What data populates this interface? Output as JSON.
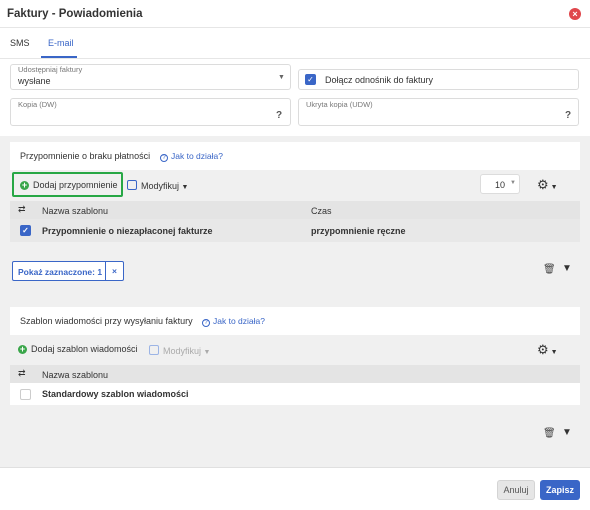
{
  "dialog": {
    "title": "Faktury - Powiadomienia",
    "close_icon": "close-icon"
  },
  "tabs": [
    {
      "label": "SMS"
    },
    {
      "label": "E-mail",
      "active": true
    }
  ],
  "form": {
    "share": {
      "label": "Udostępniaj faktury",
      "value": "wysłane"
    },
    "attach_link": {
      "label": "Dołącz odnośnik do faktury",
      "checked": true
    },
    "cc": {
      "label": "Kopia (DW)",
      "help": "?"
    },
    "bcc": {
      "label": "Ukryta kopia (UDW)",
      "help": "?"
    }
  },
  "reminders": {
    "title": "Przypomnienie o braku płatności",
    "help": "Jak to działa?",
    "add_label": "Dodaj przypomnienie",
    "modify_label": "Modyfikuj",
    "page_size": "10",
    "columns": [
      "Nazwa szablonu",
      "Czas"
    ],
    "rows": [
      {
        "name": "Przypomnienie o niezapłaconej fakturze",
        "time": "przypomnienie ręczne",
        "checked": true
      }
    ],
    "show_selected": "Pokaż zaznaczone: 1",
    "clear": "×"
  },
  "templates": {
    "title": "Szablon wiadomości przy wysyłaniu faktury",
    "help": "Jak to działa?",
    "add_label": "Dodaj szablon wiadomości",
    "modify_label": "Modyfikuj",
    "columns": [
      "Nazwa szablonu"
    ],
    "rows": [
      {
        "name": "Standardowy szablon wiadomości",
        "checked": false
      }
    ]
  },
  "footer": {
    "cancel": "Anuluj",
    "save": "Zapisz"
  },
  "colors": {
    "accent": "#3a66c7",
    "highlight": "#27a745",
    "close": "#e0474c"
  }
}
